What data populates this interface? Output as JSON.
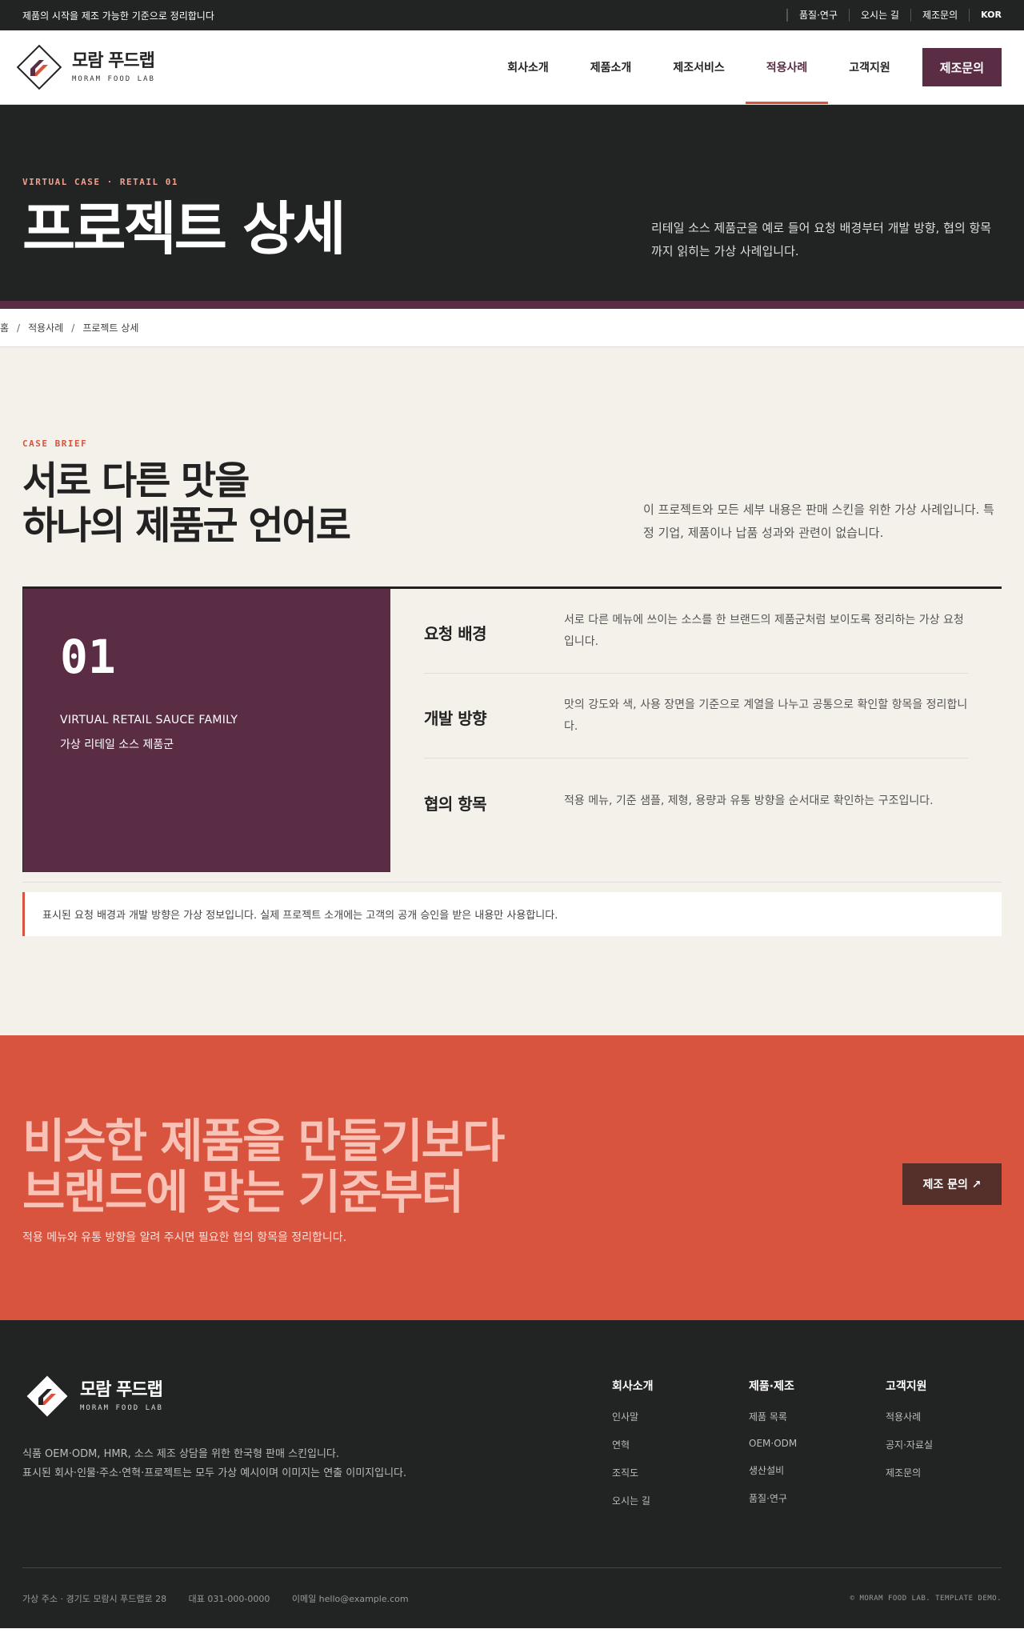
{
  "topbar": {
    "tagline": "제품의 시작을 제조 가능한 기준으로 정리합니다",
    "links": [
      "품질·연구",
      "오시는 길",
      "제조문의"
    ],
    "lang": "KOR"
  },
  "brand": {
    "name_ko": "모람 푸드랩",
    "name_en": "MORAM FOOD LAB"
  },
  "nav": {
    "items": [
      "회사소개",
      "제품소개",
      "제조서비스",
      "적용사례",
      "고객지원"
    ],
    "active": "적용사례",
    "cta": "제조문의"
  },
  "hero": {
    "eyebrow": "VIRTUAL CASE · RETAIL 01",
    "title": "프로젝트 상세",
    "desc": "리테일 소스 제품군을 예로 들어 요청 배경부터 개발 방향, 협의 항목까지 읽히는 가상 사례입니다."
  },
  "breadcrumb": [
    "홈",
    "적용사례",
    "프로젝트 상세"
  ],
  "brief": {
    "eyebrow": "CASE BRIEF",
    "title_line1": "서로 다른 맛을",
    "title_line2": "하나의 제품군 언어로",
    "desc": "이 프로젝트와 모든 세부 내용은 판매 스킨을 위한 가상 사례입니다. 특정 기업, 제품이나 납품 성과와 관련이 없습니다."
  },
  "case": {
    "number": "01",
    "name_en": "VIRTUAL RETAIL SAUCE FAMILY",
    "name_ko": "가상 리테일 소스 제품군",
    "rows": [
      {
        "label": "요청 배경",
        "value": "서로 다른 메뉴에 쓰이는 소스를 한 브랜드의 제품군처럼 보이도록 정리하는 가상 요청입니다."
      },
      {
        "label": "개발 방향",
        "value": "맛의 강도와 색, 사용 장면을 기준으로 계열을 나누고 공통으로 확인할 항목을 정리합니다."
      },
      {
        "label": "협의 항목",
        "value": "적용 메뉴, 기준 샘플, 제형, 용량과 유통 방향을 순서대로 확인하는 구조입니다."
      }
    ],
    "note": "표시된 요청 배경과 개발 방향은 가상 정보입니다. 실제 프로젝트 소개에는 고객의 공개 승인을 받은 내용만 사용합니다."
  },
  "cta": {
    "title_line1": "비슷한 제품을 만들기보다",
    "title_line2": "브랜드에 맞는 기준부터",
    "sub": "적용 메뉴와 유통 방향을 알려 주시면 필요한 협의 항목을 정리합니다.",
    "button": "제조 문의 ↗"
  },
  "footer": {
    "desc_line1": "식품 OEM·ODM, HMR, 소스 제조 상담을 위한 한국형 판매 스킨입니다.",
    "desc_line2": "표시된 회사·인물·주소·연혁·프로젝트는 모두 가상 예시이며 이미지는 연출 이미지입니다.",
    "columns": [
      {
        "title": "회사소개",
        "links": [
          "인사말",
          "연혁",
          "조직도",
          "오시는 길"
        ]
      },
      {
        "title": "제품·제조",
        "links": [
          "제품 목록",
          "OEM·ODM",
          "생산설비",
          "품질·연구"
        ]
      },
      {
        "title": "고객지원",
        "links": [
          "적용사례",
          "공지·자료실",
          "제조문의"
        ]
      }
    ],
    "address": "가상 주소 · 경기도 모람시 푸드랩로 28",
    "phone": "대표 031-000-0000",
    "email": "이메일 hello@example.com",
    "copyright": "© MORAM FOOD LAB. TEMPLATE DEMO."
  },
  "colors": {
    "dark": "#222423",
    "plum": "#5a2d45",
    "coral": "#d9543f",
    "cream": "#f4f1ea"
  }
}
